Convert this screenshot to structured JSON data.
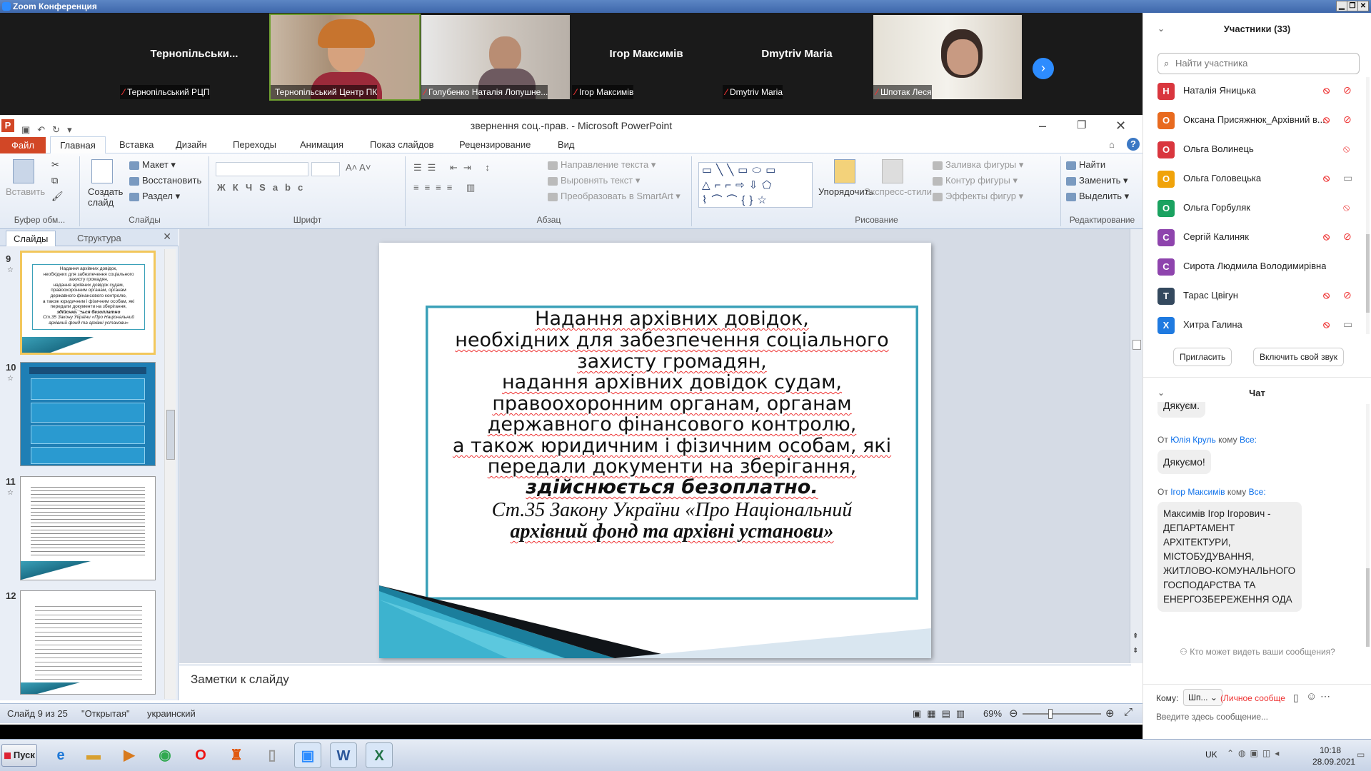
{
  "zoom_title": "Zoom Конференция",
  "gallery": [
    {
      "name": "Тернопільськи...",
      "label": "Тернопільський РЦП",
      "video": false
    },
    {
      "name": "",
      "label": "Тернопільський Центр ПК",
      "video": true
    },
    {
      "name": "",
      "label": "Голубенко Наталія Лопушне...",
      "video": true
    },
    {
      "name": "Ігор Максимів",
      "label": "Ігор Максимів",
      "video": false
    },
    {
      "name": "Dmytriv Maria",
      "label": "Dmytriv Maria",
      "video": false
    },
    {
      "name": "",
      "label": "Шпотак Леся",
      "video": true
    }
  ],
  "ppt": {
    "title": "звернення соц.-прав.  -  Microsoft PowerPoint",
    "tabs": [
      "Файл",
      "Главная",
      "Вставка",
      "Дизайн",
      "Переходы",
      "Анимация",
      "Показ слайдов",
      "Рецензирование",
      "Вид"
    ],
    "ribbon": {
      "clipboard": {
        "paste": "Вставить",
        "group": "Буфер обм..."
      },
      "slides": {
        "new_slide": "Создать слайд",
        "layout": "Макет",
        "reset": "Восстановить",
        "section": "Раздел",
        "group": "Слайды"
      },
      "font": {
        "group": "Шрифт"
      },
      "paragraph": {
        "text_direction": "Направление текста",
        "align_text": "Выровнять текст",
        "smartart": "Преобразовать в SmartArt",
        "group": "Абзац"
      },
      "drawing": {
        "arrange": "Упорядочить",
        "quick_styles": "Экспресс-стили",
        "shape_fill": "Заливка фигуры",
        "shape_outline": "Контур фигуры",
        "shape_effects": "Эффекты фигур",
        "group": "Рисование"
      },
      "editing": {
        "find": "Найти",
        "replace": "Заменить",
        "select": "Выделить",
        "group": "Редактирование"
      }
    },
    "panel_tabs": [
      "Слайды",
      "Структура"
    ],
    "thumbnails": [
      {
        "num": "9",
        "lines": [
          "Надання архівних довідок,",
          "необхідних для забезпечення соціального",
          "захисту громадян,",
          "надання архівних довідок судам,",
          "правоохоронним органам, органам",
          "державного фінансового контролю,",
          "а також юридичним і фізичним особам, які",
          "передали документи на зберігання,",
          "здійснюється безоплатно",
          "Ст.35 Закону України «Про Національний",
          "архівний фонд та архівні установи»"
        ]
      },
      {
        "num": "10"
      },
      {
        "num": "11"
      },
      {
        "num": "12"
      }
    ],
    "slide_lines": [
      "Надання архівних довідок,",
      "необхідних для забезпечення соціального",
      "захисту громадян,",
      "надання архівних довідок судам,",
      "правоохоронним органам, органам",
      "державного фінансового контролю,",
      "а також юридичним і фізичним особам, які",
      "передали документи на зберігання,",
      "здійснюється  безоплатно.",
      "Ст.35 Закону України «Про Національний",
      "архівний фонд та архівні установи»"
    ],
    "notes_placeholder": "Заметки к слайду",
    "status": {
      "slide": "Слайд 9 из 25",
      "theme": "\"Открытая\"",
      "language": "украинский",
      "zoom": "69%"
    }
  },
  "participants": {
    "header": "Участники (33)",
    "search_placeholder": "Найти участника",
    "list": [
      {
        "initial": "Н",
        "name": "Наталія Яницька",
        "color": "#d9363e",
        "video": "off"
      },
      {
        "initial": "О",
        "name": "Оксана Присяжнюк_Архівний в...",
        "color": "#e86a1f",
        "video": "off"
      },
      {
        "initial": "О",
        "name": "Ольга Волинець",
        "color": "#d9363e",
        "video": "none"
      },
      {
        "initial": "О",
        "name": "Ольга Головецька",
        "color": "#f0a30a",
        "video": "on"
      },
      {
        "initial": "О",
        "name": "Ольга Горбуляк",
        "color": "#1aa260",
        "video": "none"
      },
      {
        "initial": "С",
        "name": "Сергій Калиняк",
        "color": "#8e44ad",
        "video": "off"
      },
      {
        "initial": "С",
        "name": "Сирота Людмила Володимирівна",
        "color": "#8e44ad",
        "video": "off"
      },
      {
        "initial": "Т",
        "name": "Тарас Цвігун",
        "color": "#34495e",
        "video": "off"
      },
      {
        "initial": "Х",
        "name": "Хитра Галина",
        "color": "#1f7ae0",
        "video": "on"
      }
    ],
    "invite": "Пригласить",
    "unmute": "Включить свой звук"
  },
  "chat": {
    "header": "Чат",
    "partial_msg": "Дякуєм.",
    "messages": [
      {
        "from_prefix": "От",
        "from": "Юлія Круль",
        "to_prefix": "кому",
        "to": "Все:",
        "text": "Дякуємо!"
      },
      {
        "from_prefix": "От",
        "from": "Ігор Максимів",
        "to_prefix": "кому",
        "to": "Все:",
        "text": "Максимів Ігор Ігорович - ДЕПАРТАМЕНТ АРХІТЕКТУРИ, МІСТОБУДУВАННЯ, ЖИТЛОВО-КОМУНАЛЬНОГО ГОСПОДАРСТВА ТА ЕНЕРГОЗБЕРЕЖЕННЯ ОДА"
      }
    ],
    "who_can_see": "Кто может видеть ваши сообщения?",
    "to_label": "Кому:",
    "to_value": "Шп...",
    "private": "(Личное сообще",
    "input_placeholder": "Введите здесь сообщение..."
  },
  "taskbar": {
    "start": "Пуск",
    "lang": "UK",
    "time": "10:18",
    "date": "28.09.2021"
  }
}
